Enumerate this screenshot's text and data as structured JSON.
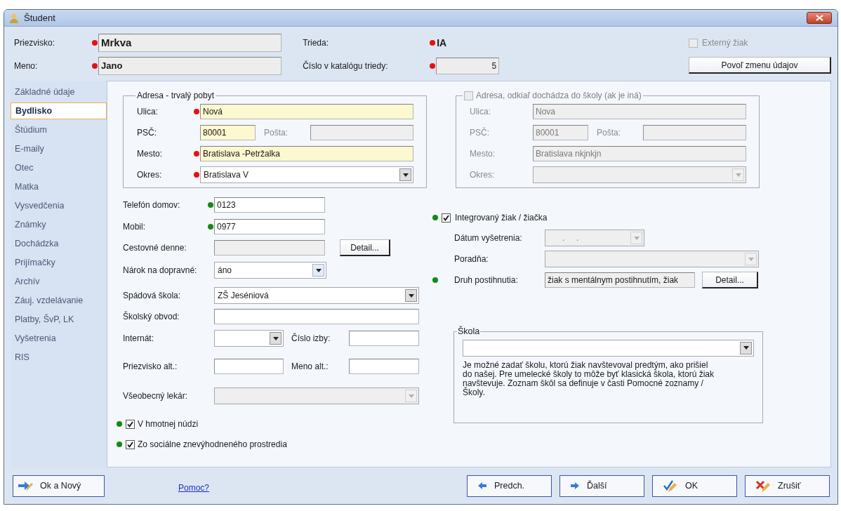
{
  "window": {
    "title": "Študent"
  },
  "header": {
    "surname": {
      "label": "Priezvisko:",
      "value": "Mrkva",
      "color": "#e81010"
    },
    "first_name": {
      "label": "Meno:",
      "value": "Jano",
      "color": "#e81010"
    },
    "class": {
      "label": "Trieda:",
      "value": "IA",
      "color": "#e81010"
    },
    "catalog_number": {
      "label": "Číslo v katalógu triedy:",
      "value": "5",
      "color": "#e81010"
    },
    "external_student": {
      "label": "Externý žiak",
      "checked": false,
      "disabled": true
    },
    "unlock_button": "Povoľ zmenu údajov"
  },
  "sidebar": {
    "items": [
      {
        "label": "Základné údaje",
        "selected": false
      },
      {
        "label": "Bydlisko",
        "selected": true
      },
      {
        "label": "Štúdium",
        "selected": false
      },
      {
        "label": "E-maily",
        "selected": false
      },
      {
        "label": "Otec",
        "selected": false
      },
      {
        "label": "Matka",
        "selected": false
      },
      {
        "label": "Vysvedčenia",
        "selected": false
      },
      {
        "label": "Známky",
        "selected": false
      },
      {
        "label": "Dochádzka",
        "selected": false
      },
      {
        "label": "Prijímačky",
        "selected": false
      },
      {
        "label": "Archív",
        "selected": false
      },
      {
        "label": "Záuj. vzdelávanie",
        "selected": false
      },
      {
        "label": "Platby, ŠvP, LK",
        "selected": false
      },
      {
        "label": "Vyšetrenia",
        "selected": false
      },
      {
        "label": "RIS",
        "selected": false
      }
    ]
  },
  "permanent_address": {
    "title": "Adresa - trvalý pobyt",
    "street": {
      "label": "Ulica:",
      "value": "Nová",
      "color": "#e81010",
      "highlighted": true,
      "disabled": false
    },
    "postal_code": {
      "label": "PSČ:",
      "value": "80001",
      "highlighted": true,
      "disabled": false
    },
    "post_office": {
      "label": "Pošta:",
      "disabled": true
    },
    "city": {
      "label": "Mesto:",
      "value": "Bratislava -Petržalka",
      "color": "#e81010",
      "highlighted": true,
      "disabled": false
    },
    "district": {
      "label": "Okres:",
      "value": "Bratislava V",
      "color": "#e81010",
      "disabled": false
    }
  },
  "school_address": {
    "title": "Adresa, odkiaľ dochádza do školy (ak je iná)",
    "checked": false,
    "disabled": true,
    "street": {
      "label": "Ulica:",
      "value": "Nova",
      "disabled": true
    },
    "postal_code": {
      "label": "PSČ:",
      "value": "80001",
      "disabled": true
    },
    "post_office": {
      "label": "Pošta:",
      "disabled": true
    },
    "city": {
      "label": "Mesto:",
      "value": "Bratislava nkjnkjn",
      "disabled": true
    },
    "district": {
      "label": "Okres:",
      "disabled": true
    }
  },
  "contact": {
    "home_phone": {
      "label": "Telefón domov:",
      "value": "0123",
      "color": "#138a13",
      "disabled": false
    },
    "mobile": {
      "label": "Mobil:",
      "value": "0977",
      "color": "#138a13",
      "disabled": false
    },
    "travel_daily": {
      "label": "Cestovné denne:",
      "disabled": true
    },
    "detail_button": "Detail...",
    "transport_claim": {
      "label": "Nárok na dopravné:",
      "value": "áno",
      "disabled": false
    },
    "catchment_school": {
      "label": "Spádová škola:",
      "value": "ZŠ Jeséniová",
      "disabled": false
    },
    "school_district": {
      "label": "Školský obvod:",
      "disabled": false
    },
    "dormitory": {
      "label": "Internát:",
      "disabled": false
    },
    "room_number": {
      "label": "Číslo izby:",
      "disabled": false
    },
    "surname_alt": {
      "label": "Priezvisko alt.:",
      "disabled": false
    },
    "name_alt": {
      "label": "Meno alt.:",
      "disabled": false
    },
    "general_practitioner": {
      "label": "Všeobecný lekár:",
      "disabled": true
    }
  },
  "flags": [
    {
      "label": "V hmotnej núdzi",
      "checked": true,
      "color": "#138a13"
    },
    {
      "label": "Zo sociálne znevýhodneného prostredia",
      "checked": true,
      "color": "#138a13"
    }
  ],
  "integration": {
    "checkbox": {
      "label": "Integrovaný žiak / žiačka",
      "checked": true,
      "color": "#138a13"
    },
    "exam_date": {
      "label": "Dátum vyšetrenia:",
      "value": ".     .",
      "disabled": true
    },
    "counseling": {
      "label": "Poradňa:",
      "disabled": true
    },
    "disability": {
      "label": "Druh postihnutia:",
      "value": "žiak s mentálnym postihnutím, žiak",
      "color": "#138a13",
      "disabled": true
    },
    "detail_button": "Detail..."
  },
  "previous_school": {
    "title": "Škola",
    "note": "Je možné zadať školu, ktorú žiak navštevoval predtým, ako prišiel do našej. Pre umelecké školy to môže byť klasická škola, ktorú žiak navštevuje. Zoznam škôl sa definuje v časti Pomocné zoznamy / Školy."
  },
  "footer": {
    "left_button": {
      "kind": "ok_new",
      "label": "Ok a Nový"
    },
    "help_link": "Pomoc?",
    "buttons": [
      {
        "kind": "prev",
        "label": "Predch."
      },
      {
        "kind": "next",
        "label": "Ďalší"
      },
      {
        "kind": "ok",
        "label": "OK"
      },
      {
        "kind": "cancel",
        "label": "Zrušiť"
      }
    ]
  }
}
